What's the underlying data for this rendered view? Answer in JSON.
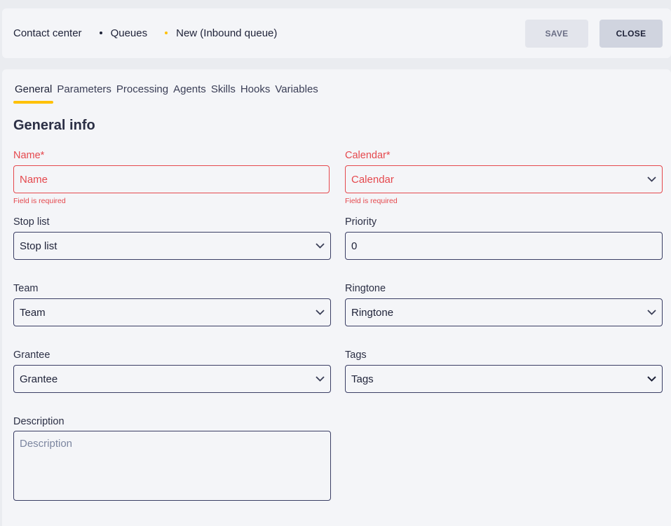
{
  "header": {
    "breadcrumb": [
      "Contact center",
      "Queues",
      "New (Inbound queue)"
    ],
    "save_label": "SAVE",
    "close_label": "CLOSE"
  },
  "tabs": [
    "General",
    "Parameters",
    "Processing",
    "Agents",
    "Skills",
    "Hooks",
    "Variables"
  ],
  "active_tab": "General",
  "section_title": "General info",
  "fields": {
    "name": {
      "label": "Name*",
      "placeholder": "Name",
      "helper": "Field is required"
    },
    "calendar": {
      "label": "Calendar*",
      "placeholder": "Calendar",
      "helper": "Field is required"
    },
    "stop_list": {
      "label": "Stop list",
      "placeholder": "Stop list"
    },
    "priority": {
      "label": "Priority",
      "value": "0"
    },
    "team": {
      "label": "Team",
      "placeholder": "Team"
    },
    "ringtone": {
      "label": "Ringtone",
      "placeholder": "Ringtone"
    },
    "grantee": {
      "label": "Grantee",
      "placeholder": "Grantee"
    },
    "tags": {
      "label": "Tags",
      "placeholder": "Tags"
    },
    "description": {
      "label": "Description",
      "placeholder": "Description"
    }
  },
  "colors": {
    "accent": "#ffc107",
    "error": "#e5484d",
    "text": "#1e2238",
    "border": "#3a3e64",
    "background": "#f4f5f8"
  },
  "icons": {
    "dropdown": "chevron-down-icon"
  }
}
